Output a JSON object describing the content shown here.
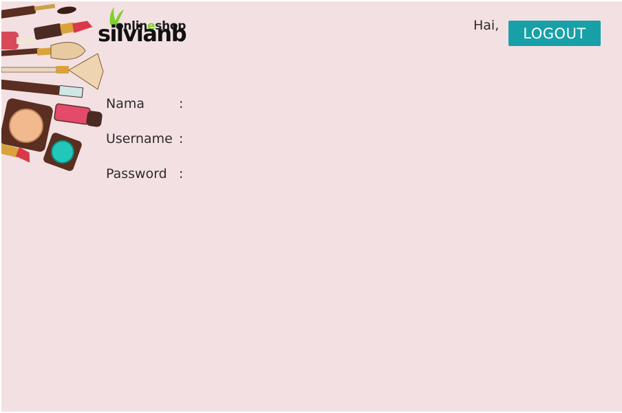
{
  "brand": {
    "tagline_part1": "onlin",
    "tagline_o": "e",
    "tagline_part2": "shop",
    "name": "silvianb"
  },
  "header": {
    "greeting": "Hai,",
    "logout_label": "LOGOUT"
  },
  "profile": {
    "fields": [
      {
        "label": "Nama",
        "separator": ":",
        "value": ""
      },
      {
        "label": "Username",
        "separator": ":",
        "value": ""
      },
      {
        "label": "Password",
        "separator": ":",
        "value": ""
      }
    ]
  },
  "colors": {
    "background": "#f3e0e2",
    "accent": "#18a0a8",
    "brand_green": "#7fd12b"
  }
}
